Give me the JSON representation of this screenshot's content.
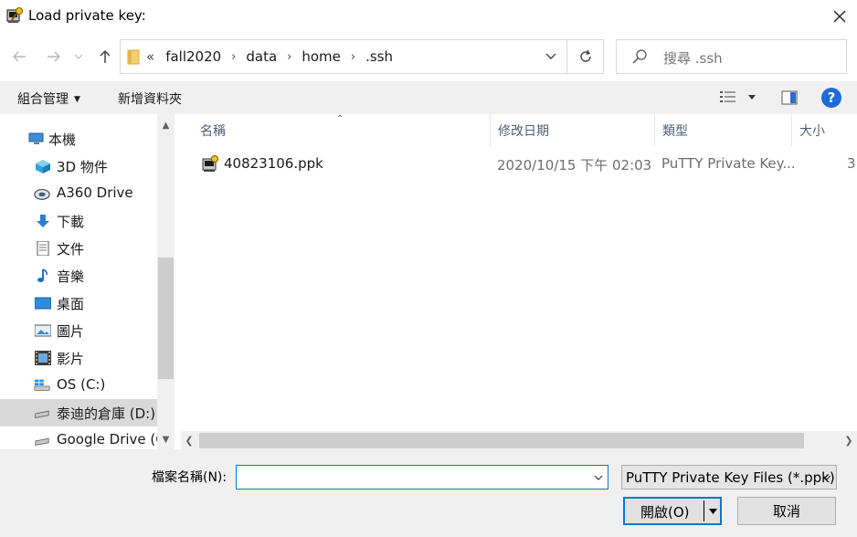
{
  "window": {
    "title": "Load private key:"
  },
  "address": {
    "crumbs": [
      "fall2020",
      "data",
      "home",
      ".ssh"
    ],
    "overflow": "«"
  },
  "search": {
    "placeholder": "搜尋 .ssh"
  },
  "toolbar": {
    "organize": "組合管理",
    "new_folder": "新增資料夾",
    "help": "?"
  },
  "sidebar": {
    "items": [
      {
        "label": "本機",
        "icon": "computer-icon"
      },
      {
        "label": "3D 物件",
        "icon": "cube-icon"
      },
      {
        "label": "A360 Drive",
        "icon": "cloud-drive-icon"
      },
      {
        "label": "下載",
        "icon": "download-icon"
      },
      {
        "label": "文件",
        "icon": "document-icon"
      },
      {
        "label": "音樂",
        "icon": "music-icon"
      },
      {
        "label": "桌面",
        "icon": "desktop-icon"
      },
      {
        "label": "圖片",
        "icon": "picture-icon"
      },
      {
        "label": "影片",
        "icon": "video-icon"
      },
      {
        "label": "OS (C:)",
        "icon": "windows-drive-icon"
      },
      {
        "label": "泰迪的倉庫 (D:)",
        "icon": "drive-icon"
      },
      {
        "label": "Google Drive (G:)",
        "icon": "drive-icon"
      }
    ],
    "selected_index": 10
  },
  "columns": [
    "名稱",
    "修改日期",
    "類型",
    "大小"
  ],
  "files": [
    {
      "name": "40823106.ppk",
      "modified": "2020/10/15 下午 02:03",
      "type": "PuTTY Private Key...",
      "size": "3"
    }
  ],
  "footer": {
    "filename_label": "檔案名稱(N):",
    "filename_value": "",
    "filter": "PuTTY Private Key Files (*.ppk)",
    "open_label": "開啟(O)",
    "cancel_label": "取消"
  },
  "colors": {
    "accent": "#0078d7",
    "help": "#1c6bd6",
    "selected": "#d9d9d9",
    "header_text": "#4c607a"
  }
}
